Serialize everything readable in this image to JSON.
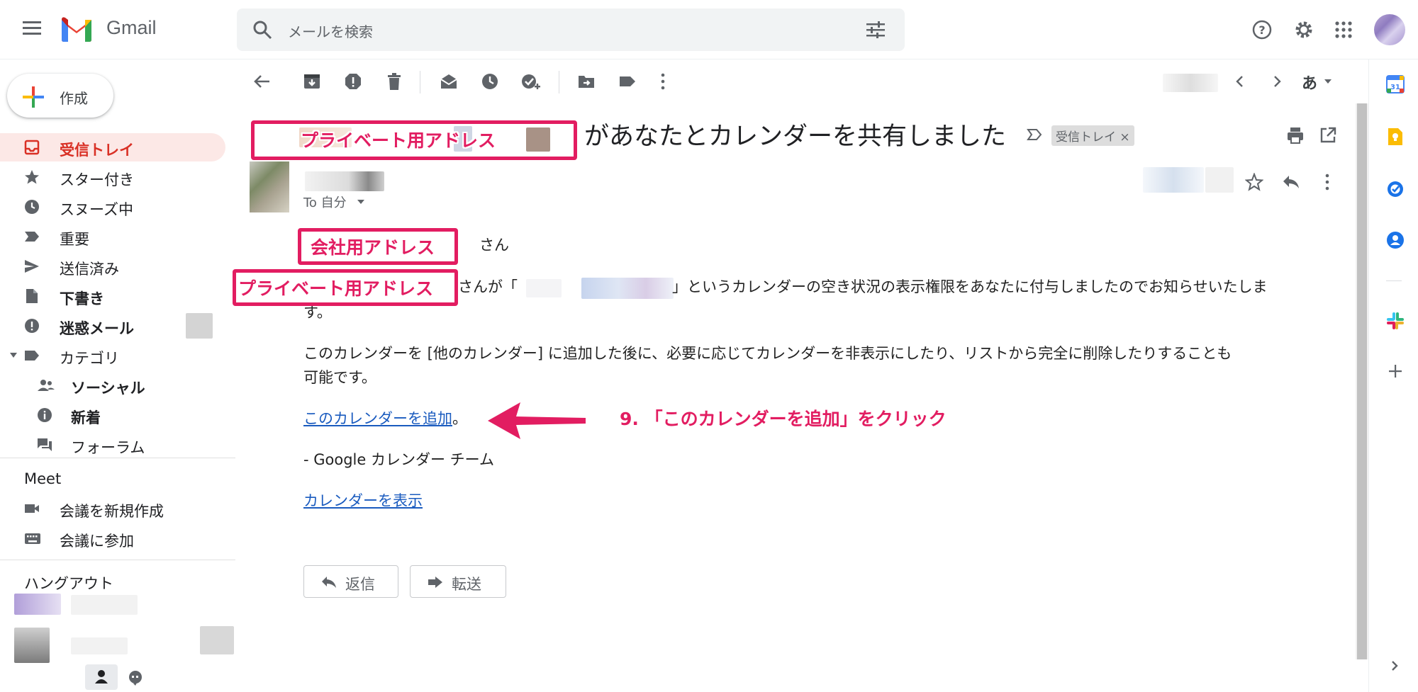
{
  "app": {
    "name": "Gmail"
  },
  "search": {
    "placeholder": "メールを検索"
  },
  "compose": {
    "label": "作成"
  },
  "sidebar": {
    "items": [
      {
        "label": "受信トレイ"
      },
      {
        "label": "スター付き"
      },
      {
        "label": "スヌーズ中"
      },
      {
        "label": "重要"
      },
      {
        "label": "送信済み"
      },
      {
        "label": "下書き"
      },
      {
        "label": "迷惑メール"
      },
      {
        "label": "カテゴリ"
      }
    ],
    "categories": [
      {
        "label": "ソーシャル"
      },
      {
        "label": "新着"
      },
      {
        "label": "フォーラム"
      }
    ]
  },
  "meet": {
    "title": "Meet",
    "items": [
      {
        "label": "会議を新規作成"
      },
      {
        "label": "会議に参加"
      }
    ]
  },
  "hangouts": {
    "title": "ハングアウト"
  },
  "toolbar": {
    "input_tool": "あ"
  },
  "mail": {
    "subject": "があなたとカレンダーを共有しました",
    "tag": "受信トレイ ×",
    "to": "To 自分",
    "greeting": "さん",
    "line1_pre": "さんが「",
    "line1_post": "」というカレンダーの空き状況の表示権限をあなたに付与しましたのでお知らせいたしま",
    "line1_cont": "す。",
    "line2": "このカレンダーを [他のカレンダー] に追加した後に、必要に応じてカレンダーを非表示にしたり、リストから完全に削除したりすることも",
    "line2_cont": "可能です。",
    "add_link": "このカレンダーを追加",
    "add_suffix": "。",
    "signature": "- Google カレンダー チーム",
    "view_link": "カレンダーを表示",
    "reply": "返信",
    "forward": "転送"
  },
  "annotations": {
    "private_1": "プライベート用アドレス",
    "company": "会社用アドレス",
    "private_2": "プライベート用アドレス",
    "step_note": "9. 「このカレンダーを追加」をクリック"
  },
  "colors": {
    "annotation": "#e21d61",
    "active": "#d93025",
    "link": "#1a5bbf"
  }
}
